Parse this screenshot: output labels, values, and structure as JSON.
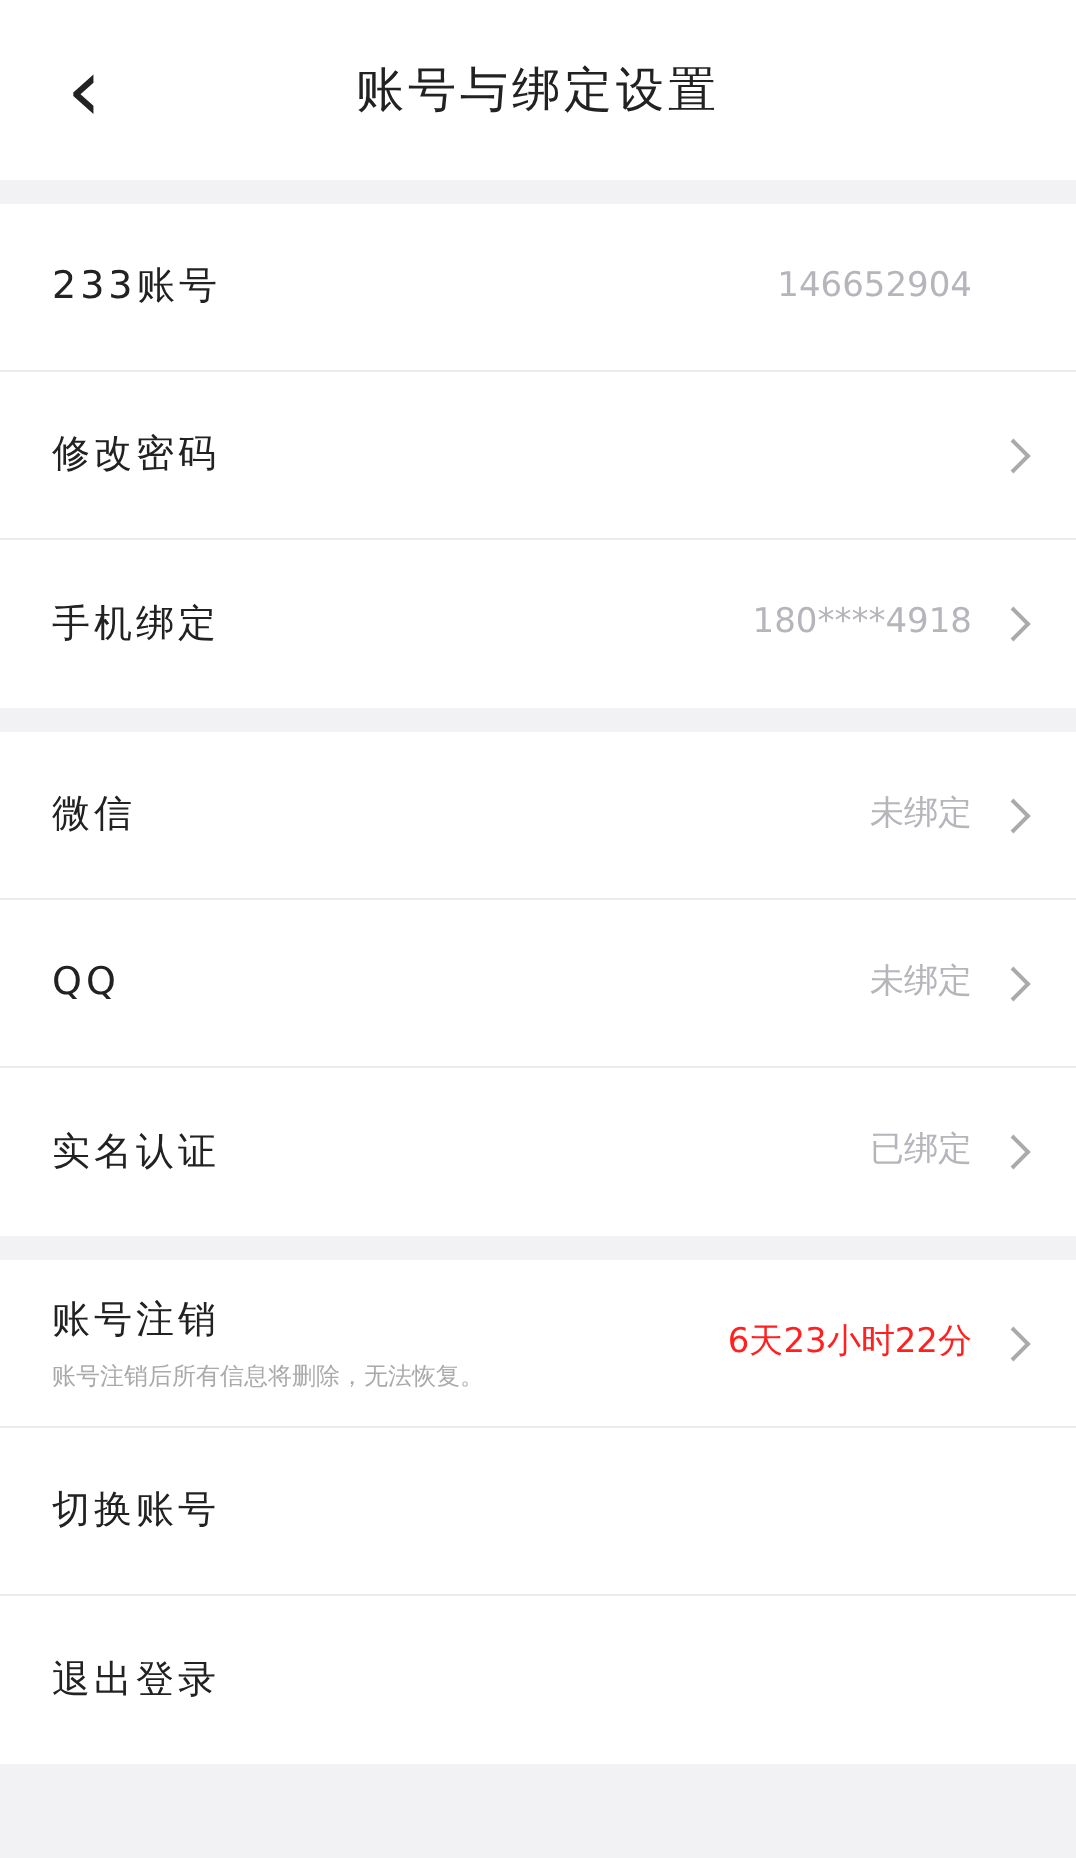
{
  "header": {
    "back": "‹",
    "title": "账号与绑定设置"
  },
  "groups": [
    {
      "rows": [
        {
          "label": "233账号",
          "value": "146652904",
          "highlight": false,
          "chevron": false
        },
        {
          "label": "修改密码",
          "chevron": true
        },
        {
          "label": "手机绑定",
          "value": "180****4918",
          "highlight": false,
          "chevron": true
        }
      ]
    },
    {
      "rows": [
        {
          "label": "微信",
          "value": "未绑定",
          "highlight": false,
          "chevron": true
        },
        {
          "label": "QQ",
          "value": "未绑定",
          "highlight": false,
          "chevron": true
        },
        {
          "label": "实名认证",
          "value": "已绑定",
          "highlight": false,
          "chevron": true
        }
      ]
    },
    {
      "rows": [
        {
          "label": "账号注销",
          "subtitle": "账号注销后所有信息将删除，无法恢复。",
          "value": "6天23小时22分",
          "highlight": true,
          "chevron": true
        },
        {
          "label": "切换账号",
          "chevron": false
        },
        {
          "label": "退出登录",
          "chevron": false
        }
      ]
    }
  ]
}
